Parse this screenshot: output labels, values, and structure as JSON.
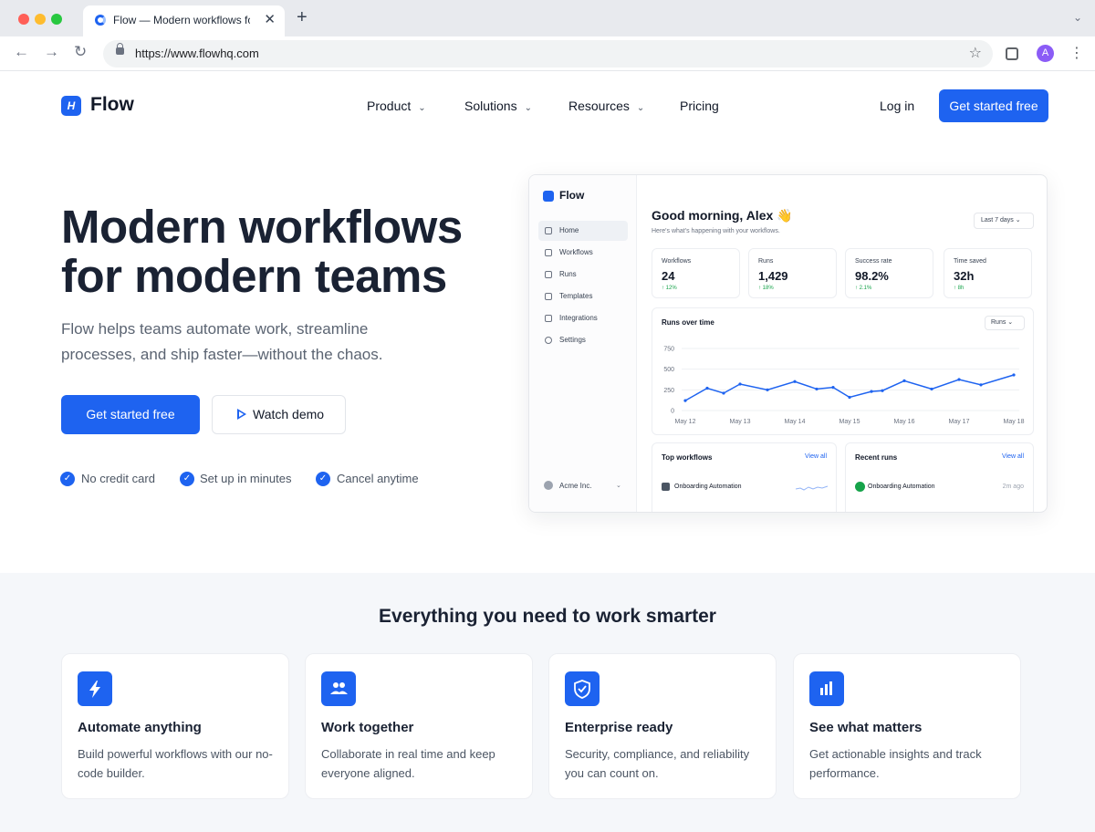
{
  "browser": {
    "tab_title": "Flow — Modern workflows for teams",
    "url": "https://www.flowhq.com",
    "profile_initial": "A"
  },
  "site": {
    "brand": "Flow",
    "nav": [
      "Product",
      "Solutions",
      "Resources",
      "Pricing"
    ],
    "login": "Log in",
    "cta": "Get started free"
  },
  "hero": {
    "title": "Modern workflows for modern teams",
    "subtitle": "Flow helps teams automate work, streamline processes, and ship faster—without the chaos.",
    "primary_button": "Get started free",
    "secondary_button": "Watch demo",
    "checks": [
      "No credit card",
      "Set up in minutes",
      "Cancel anytime"
    ]
  },
  "dashboard": {
    "brand": "Flow",
    "sidebar": [
      "Home",
      "Workflows",
      "Runs",
      "Templates",
      "Integrations",
      "Settings"
    ],
    "workspace": "Acme Inc.",
    "greeting": "Good morning, Alex 👋",
    "greeting_sub": "Here's what's happening with your workflows.",
    "range": "Last 7 days",
    "stats": [
      {
        "label": "Workflows",
        "value": "24",
        "delta": "↑ 12%"
      },
      {
        "label": "Runs",
        "value": "1,429",
        "delta": "↑ 18%"
      },
      {
        "label": "Success rate",
        "value": "98.2%",
        "delta": "↑ 2.1%"
      },
      {
        "label": "Time saved",
        "value": "32h",
        "delta": "↑ 8h"
      }
    ],
    "top_workflows": {
      "title": "Top workflows",
      "view_all": "View all",
      "row": "Onboarding Automation"
    },
    "recent_runs": {
      "title": "Recent runs",
      "view_all": "View all",
      "row": "Onboarding Automation",
      "time": "2m ago"
    }
  },
  "chart_data": {
    "type": "line",
    "title": "Runs over time",
    "filter": "Runs",
    "x": [
      "May 12",
      "May 13",
      "May 14",
      "May 15",
      "May 16",
      "May 17",
      "May 18"
    ],
    "ytick_labels": [
      "750",
      "500",
      "250",
      "0"
    ],
    "ylim": [
      0,
      750
    ],
    "series": [
      {
        "points": [
          [
            0,
            120
          ],
          [
            0.4,
            270
          ],
          [
            0.7,
            210
          ],
          [
            1.0,
            320
          ],
          [
            1.5,
            250
          ],
          [
            2.0,
            350
          ],
          [
            2.4,
            260
          ],
          [
            2.7,
            280
          ],
          [
            3.0,
            160
          ],
          [
            3.4,
            230
          ],
          [
            3.6,
            240
          ],
          [
            4.0,
            360
          ],
          [
            4.5,
            260
          ],
          [
            5.0,
            375
          ],
          [
            5.4,
            310
          ],
          [
            6.0,
            430
          ]
        ]
      }
    ],
    "color": "#1e63f0",
    "grid": true
  },
  "features": {
    "heading": "Everything you need to work smarter",
    "cards": [
      {
        "icon": "bolt-icon",
        "title": "Automate anything",
        "desc": "Build powerful workflows with our no-code builder."
      },
      {
        "icon": "team-icon",
        "title": "Work together",
        "desc": "Collaborate in real time and keep everyone aligned."
      },
      {
        "icon": "shield-icon",
        "title": "Enterprise ready",
        "desc": "Security, compliance, and reliability you can count on."
      },
      {
        "icon": "bar-chart-icon",
        "title": "See what matters",
        "desc": "Get actionable insights and track performance."
      }
    ]
  },
  "colors": {
    "accent": "#1e63f0",
    "success": "#16a34a"
  }
}
